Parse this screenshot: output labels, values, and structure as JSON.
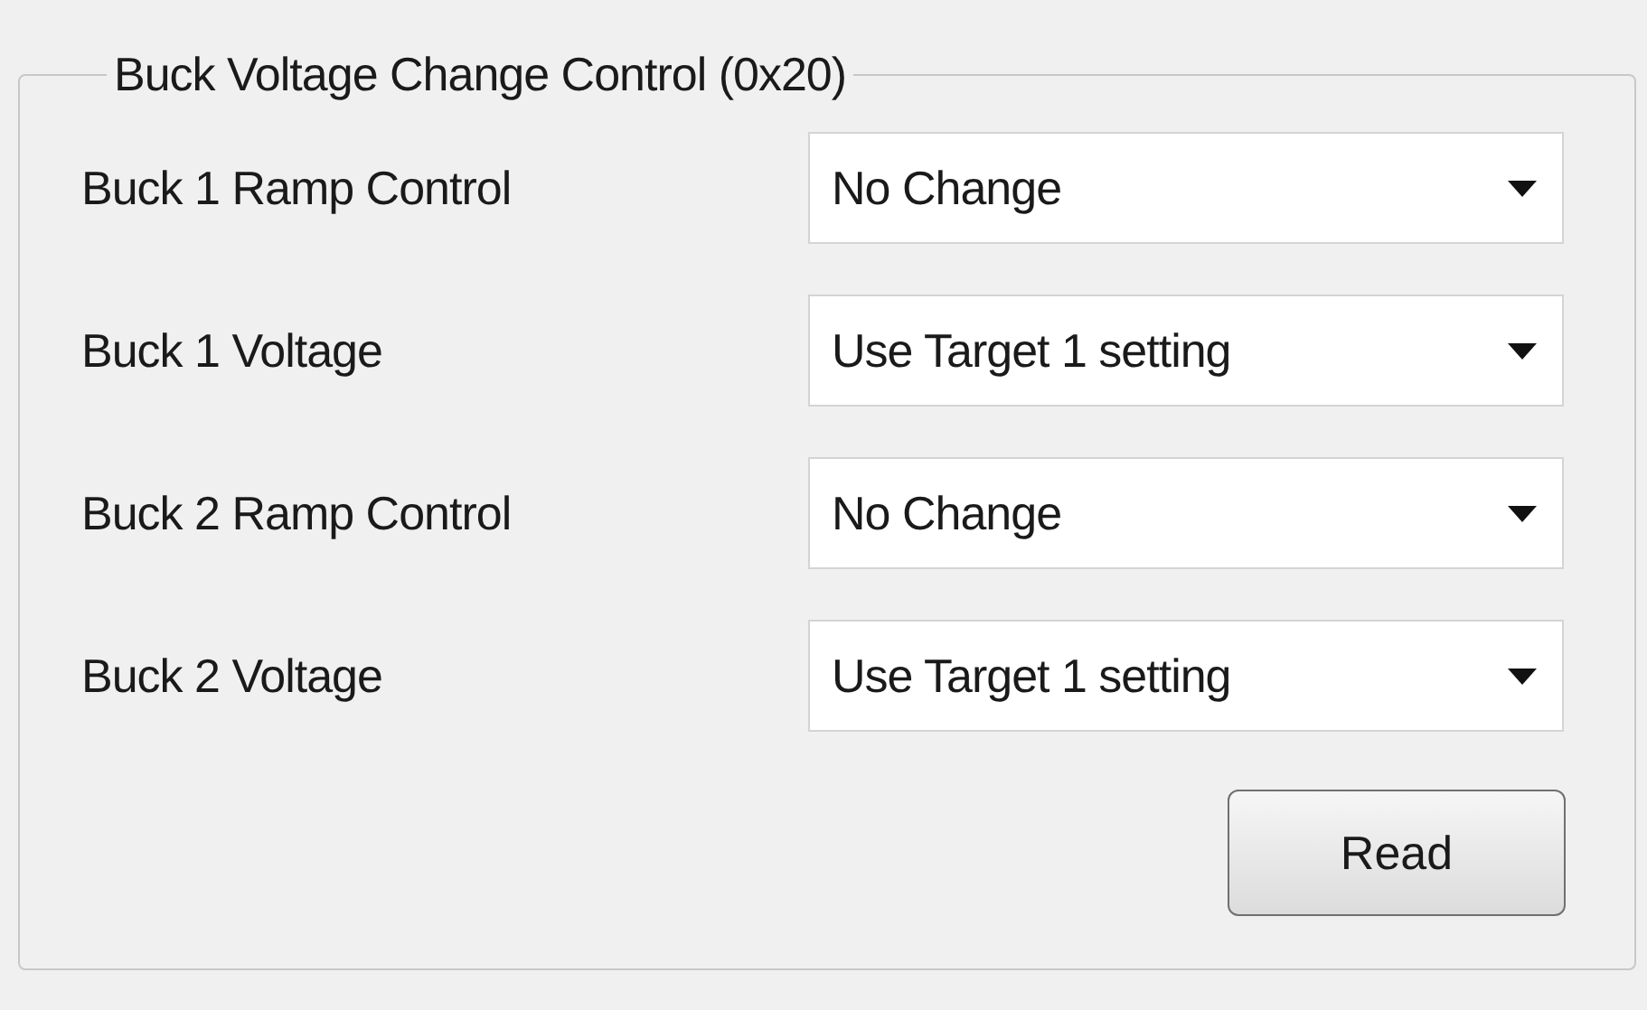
{
  "group": {
    "title": "Buck Voltage Change Control (0x20)",
    "rows": [
      {
        "label": "Buck 1 Ramp Control",
        "value": "No Change"
      },
      {
        "label": "Buck 1 Voltage",
        "value": "Use Target 1 setting"
      },
      {
        "label": "Buck 2 Ramp Control",
        "value": "No Change"
      },
      {
        "label": "Buck 2 Voltage",
        "value": "Use Target 1 setting"
      }
    ],
    "buttons": [
      "Read"
    ]
  }
}
